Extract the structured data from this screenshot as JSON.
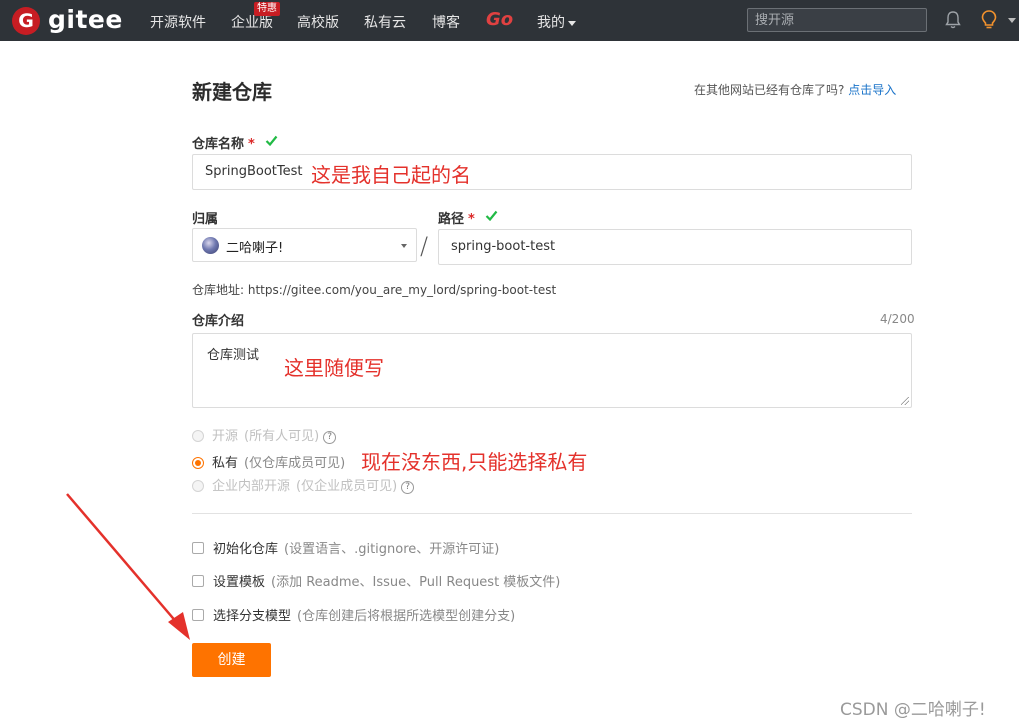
{
  "nav": {
    "logo_letter": "G",
    "logo_text": "gitee",
    "items": [
      "开源软件",
      "企业版",
      "高校版",
      "私有云",
      "博客"
    ],
    "badge": "特惠",
    "go_label": "Go",
    "mine_label": "我的",
    "search_placeholder": "搜开源"
  },
  "page": {
    "title": "新建仓库",
    "import_hint": "在其他网站已经有仓库了吗?",
    "import_link": "点击导入"
  },
  "form": {
    "name_label": "仓库名称",
    "required_mark": "*",
    "name_value": "SpringBootTest",
    "owner_label": "归属",
    "owner_value": "二哈喇子!",
    "path_label": "路径",
    "path_value": "spring-boot-test",
    "separator": "/",
    "url_label": "仓库地址:",
    "url_value": "https://gitee.com/you_are_my_lord/spring-boot-test",
    "desc_label": "仓库介绍",
    "desc_counter": "4/200",
    "desc_value": "仓库测试",
    "visibility": [
      {
        "label": "开源",
        "note": "(所有人可见)",
        "enabled": false,
        "selected": false
      },
      {
        "label": "私有",
        "note": "(仅仓库成员可见)",
        "enabled": true,
        "selected": true
      },
      {
        "label": "企业内部开源",
        "note": "(仅企业成员可见)",
        "enabled": false,
        "selected": false
      }
    ],
    "options": [
      {
        "label": "初始化仓库",
        "note": "(设置语言、.gitignore、开源许可证)",
        "checked": false
      },
      {
        "label": "设置模板",
        "note": "(添加 Readme、Issue、Pull Request 模板文件)",
        "checked": false
      },
      {
        "label": "选择分支模型",
        "note": "(仓库创建后将根据所选模型创建分支)",
        "checked": false
      }
    ],
    "create_label": "创建"
  },
  "annotations": {
    "name_note": "这是我自己起的名",
    "desc_note": "这里随便写",
    "visibility_note": "现在没东西,只能选择私有"
  },
  "watermark": "CSDN @二哈喇子!",
  "colors": {
    "nav_bg": "#2e3338",
    "brand_red": "#c71d23",
    "accent_orange": "#fe7300",
    "annotation_red": "#e4312b",
    "link_blue": "#1a73c9",
    "check_green": "#21ba45"
  },
  "icons": [
    "gitee-logo-icon",
    "bell-icon",
    "lightbulb-icon",
    "check-icon",
    "help-icon",
    "annotation-arrow"
  ]
}
